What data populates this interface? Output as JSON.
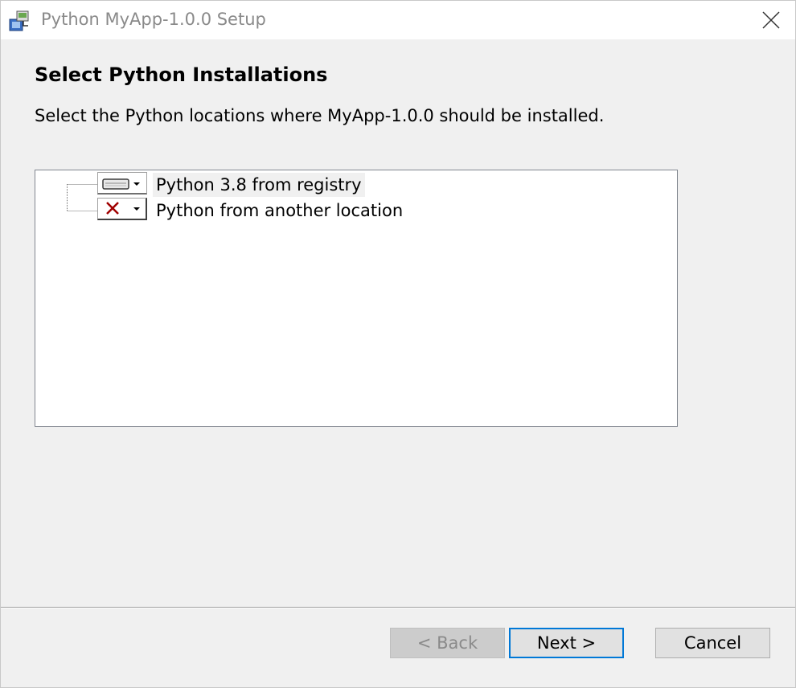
{
  "window": {
    "title": "Python MyApp-1.0.0 Setup"
  },
  "page": {
    "heading": "Select Python Installations",
    "description": "Select the Python locations where MyApp-1.0.0 should be installed."
  },
  "feature_tree": {
    "items": [
      {
        "label": "Python 3.8 from registry",
        "state_icon": "hard-drive-icon",
        "selected": true
      },
      {
        "label": "Python from another location",
        "state_icon": "red-x-icon",
        "selected": false
      }
    ]
  },
  "buttons": {
    "back": "< Back",
    "next": "Next >",
    "cancel": "Cancel"
  },
  "colors": {
    "focus_border": "#0078d7",
    "disabled_x": "#a00000"
  }
}
